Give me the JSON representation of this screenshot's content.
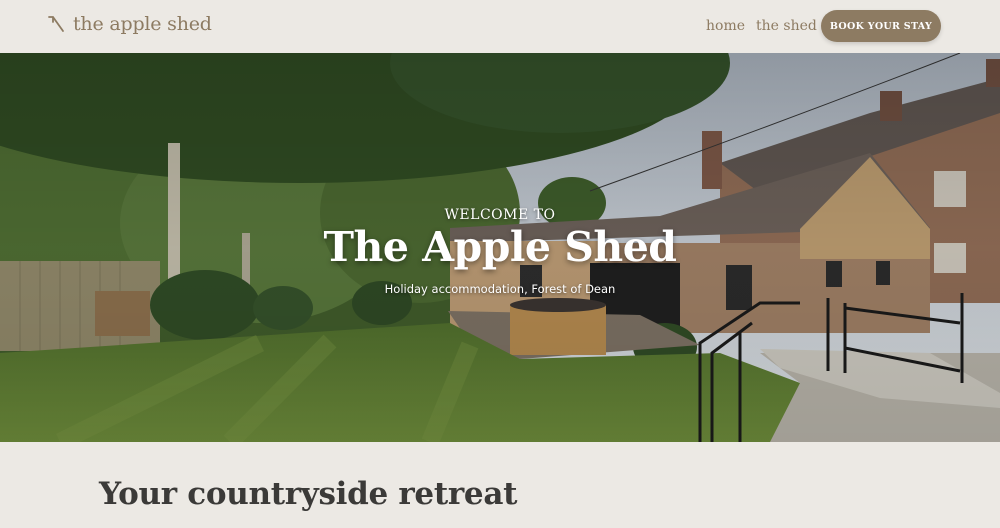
{
  "brand": {
    "name": "the apple shed",
    "icon": "apple-shed-logo-icon"
  },
  "nav": {
    "home": "home",
    "shed": "the shed",
    "cta": "BOOK YOUR STAY"
  },
  "hero": {
    "eyebrow": "WELCOME TO",
    "title": "The Apple Shed",
    "subtitle": "Holiday accommodation, Forest of Dean",
    "image": "garden-photo-with-hot-tub-and-brick-cottage"
  },
  "section": {
    "title": "Your countryside retreat"
  },
  "colors": {
    "accent": "#8d7b62",
    "background": "#ece9e4",
    "text": "#3b3a38"
  }
}
